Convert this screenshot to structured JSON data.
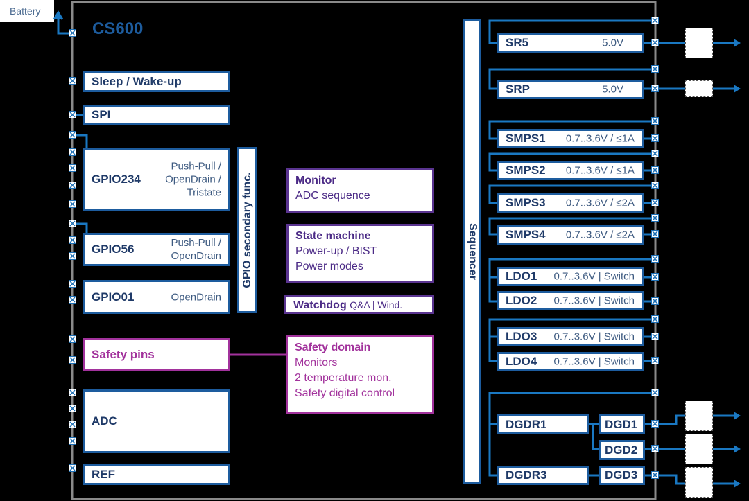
{
  "battery_label": "Battery",
  "chip_title": "CS600",
  "colors": {
    "block_border": "#1d5c9e",
    "text": "#1f3a68",
    "safety": "#a2329c",
    "wire": "#1a78c2",
    "chip_outline": "#8a8a8a"
  },
  "left_blocks": {
    "sleep": {
      "title": "Sleep / Wake-up"
    },
    "spi": {
      "title": "SPI"
    },
    "gpio234": {
      "title": "GPIO234",
      "sub": "Push-Pull / OpenDrain / Tristate"
    },
    "gpio56": {
      "title": "GPIO56",
      "sub": "Push-Pull / OpenDrain"
    },
    "gpio01": {
      "title": "GPIO01",
      "sub": "OpenDrain"
    },
    "gpio_secondary": {
      "title": "GPIO secondary func."
    },
    "safety_pins": {
      "title": "Safety pins"
    },
    "adc": {
      "title": "ADC"
    },
    "ref": {
      "title": "REF"
    }
  },
  "middle_blocks": {
    "monitor": {
      "title": "Monitor",
      "lines": [
        "ADC sequence"
      ]
    },
    "state_machine": {
      "title": "State machine",
      "lines": [
        "Power-up / BIST",
        "Power modes"
      ]
    },
    "watchdog": {
      "title": "Watchdog",
      "sub": "Q&A | Wind."
    },
    "safety_domain": {
      "title": "Safety domain",
      "lines": [
        "Monitors",
        "2 temperature mon.",
        "Safety digital control"
      ]
    }
  },
  "sequencer": {
    "title": "Sequencer"
  },
  "right_blocks": [
    {
      "title": "SR5",
      "sub": "5.0V"
    },
    {
      "title": "SRP",
      "sub": "5.0V"
    },
    {
      "title": "SMPS1",
      "sub": "0.7..3.6V / ≤1A"
    },
    {
      "title": "SMPS2",
      "sub": "0.7..3.6V / ≤1A"
    },
    {
      "title": "SMPS3",
      "sub": "0.7..3.6V / ≤2A"
    },
    {
      "title": "SMPS4",
      "sub": "0.7..3.6V / ≤2A"
    },
    {
      "title": "LDO1",
      "sub": "0.7..3.6V | Switch"
    },
    {
      "title": "LDO2",
      "sub": "0.7..3.6V | Switch"
    },
    {
      "title": "LDO3",
      "sub": "0.7..3.6V | Switch"
    },
    {
      "title": "LDO4",
      "sub": "0.7..3.6V | Switch"
    }
  ],
  "gate_drivers": {
    "dgdr1": "DGDR1",
    "dgdr3": "DGDR3",
    "dgd1": "DGD1",
    "dgd2": "DGD2",
    "dgd3": "DGD3"
  }
}
